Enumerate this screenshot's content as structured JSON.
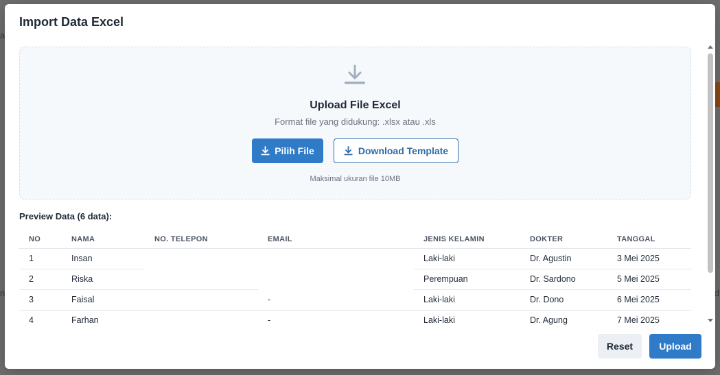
{
  "background": {
    "left_fragments": [
      "al",
      "na"
    ],
    "right_fragments": [
      "d"
    ]
  },
  "modal": {
    "title": "Import Data Excel"
  },
  "dropzone": {
    "icon": "download-icon",
    "title": "Upload File Excel",
    "subtitle": "Format file yang didukung: .xlsx atau .xls",
    "choose_file_label": "Pilih File",
    "download_template_label": "Download Template",
    "note": "Maksimal ukuran file 10MB"
  },
  "preview": {
    "title": "Preview Data (6 data):",
    "columns": [
      "NO",
      "NAMA",
      "NO. TELEPON",
      "EMAIL",
      "JENIS KELAMIN",
      "DOKTER",
      "TANGGAL"
    ],
    "rows": [
      [
        "1",
        "Insan",
        "",
        "",
        "Laki-laki",
        "Dr. Agustin",
        "3 Mei 2025"
      ],
      [
        "2",
        "Riska",
        "",
        "",
        "Perempuan",
        "Dr. Sardono",
        "5 Mei 2025"
      ],
      [
        "3",
        "Faisal",
        "",
        "-",
        "Laki-laki",
        "Dr. Dono",
        "6 Mei 2025"
      ],
      [
        "4",
        "Farhan",
        "",
        "-",
        "Laki-laki",
        "Dr. Agung",
        "7 Mei 2025"
      ]
    ]
  },
  "footer": {
    "reset_label": "Reset",
    "upload_label": "Upload"
  },
  "colors": {
    "primary": "#2f7bc8",
    "outline": "#2f6aa8",
    "overlay": "#6f6f6f"
  }
}
